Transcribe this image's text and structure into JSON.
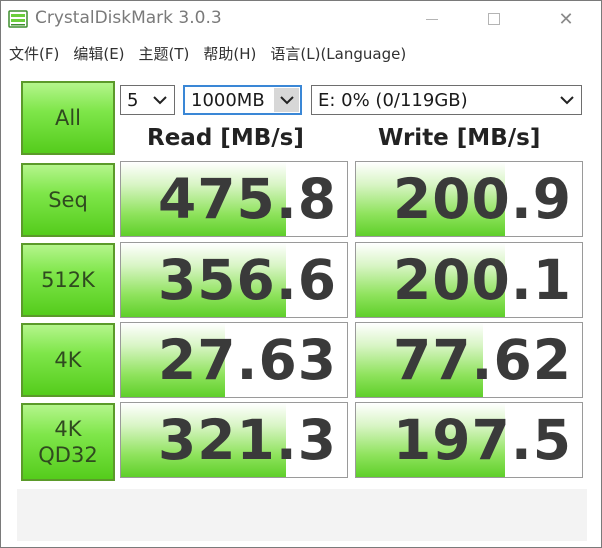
{
  "window": {
    "title": "CrystalDiskMark 3.0.3",
    "close_glyph": "✕"
  },
  "menu": [
    {
      "label": "文件(F)"
    },
    {
      "label": "编辑(E)"
    },
    {
      "label": "主题(T)"
    },
    {
      "label": "帮助(H)"
    },
    {
      "label": "语言(L)(Language)"
    }
  ],
  "controls": {
    "all_label": "All",
    "runs_value": "5",
    "size_value": "1000MB",
    "drive_value": "E: 0% (0/119GB)",
    "dropdown_glyph": "❯"
  },
  "headers": {
    "read": "Read [MB/s]",
    "write": "Write [MB/s]"
  },
  "tests": [
    {
      "label_line1": "Seq",
      "label_line2": "",
      "read": "475.8",
      "write": "200.9",
      "read_fill": 0.73,
      "write_fill": 0.66
    },
    {
      "label_line1": "512K",
      "label_line2": "",
      "read": "356.6",
      "write": "200.1",
      "read_fill": 0.73,
      "write_fill": 0.66
    },
    {
      "label_line1": "4K",
      "label_line2": "",
      "read": "27.63",
      "write": "77.62",
      "read_fill": 0.46,
      "write_fill": 0.56
    },
    {
      "label_line1": "4K",
      "label_line2": "QD32",
      "read": "321.3",
      "write": "197.5",
      "read_fill": 0.73,
      "write_fill": 0.66
    }
  ],
  "colors": {
    "button_green": "#7fe64a",
    "bar_green": "#5fcf2a",
    "value_text": "#3a3a3a"
  }
}
